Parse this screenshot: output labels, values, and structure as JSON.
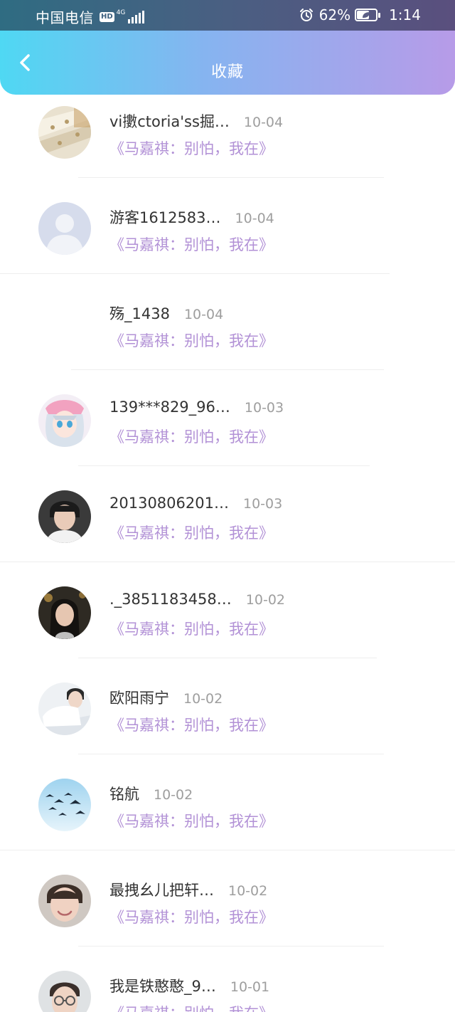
{
  "status_bar": {
    "carrier": "中国电信",
    "hd_badge": "HD",
    "network": "4G",
    "battery_percent": "62%",
    "battery_level": 0.62,
    "time": "1:14"
  },
  "nav": {
    "back_icon": "chevron-left-icon",
    "title": "收藏"
  },
  "colors": {
    "gradient_start": "#4fd8f3",
    "gradient_end": "#b79be8",
    "story_title": "#b291d6",
    "username": "#333333",
    "date": "#9e9e9e"
  },
  "items": [
    {
      "username": "vi擻ctoria'ss掘…",
      "date": "10-04",
      "story": "《马嘉祺：别怕，我在》",
      "avatar": "fabric-photo"
    },
    {
      "username": "游客1612583…",
      "date": "10-04",
      "story": "《马嘉祺：别怕，我在》",
      "avatar": "default-avatar"
    },
    {
      "username": "殇_1438",
      "date": "10-04",
      "story": "《马嘉祺：别怕，我在》",
      "avatar": "none"
    },
    {
      "username": "139***829_96…",
      "date": "10-03",
      "story": "《马嘉祺：别怕，我在》",
      "avatar": "anime-girl"
    },
    {
      "username": "20130806201…",
      "date": "10-03",
      "story": "《马嘉祺：别怕，我在》",
      "avatar": "boy-portrait"
    },
    {
      "username": "._3851183458…",
      "date": "10-02",
      "story": "《马嘉祺：别怕，我在》",
      "avatar": "girl-portrait"
    },
    {
      "username": "欧阳雨宁",
      "date": "10-02",
      "story": "《马嘉祺：别怕，我在》",
      "avatar": "boy-white-shirt"
    },
    {
      "username": "铭航",
      "date": "10-02",
      "story": "《马嘉祺：别怕，我在》",
      "avatar": "swallows-sky"
    },
    {
      "username": "最拽幺儿把轩…",
      "date": "10-02",
      "story": "《马嘉祺：别怕，我在》",
      "avatar": "smiling-boy"
    },
    {
      "username": "我是铁憨憨_9…",
      "date": "10-01",
      "story": "《马嘉祺：别怕，我在》",
      "avatar": "boy-glasses"
    }
  ]
}
